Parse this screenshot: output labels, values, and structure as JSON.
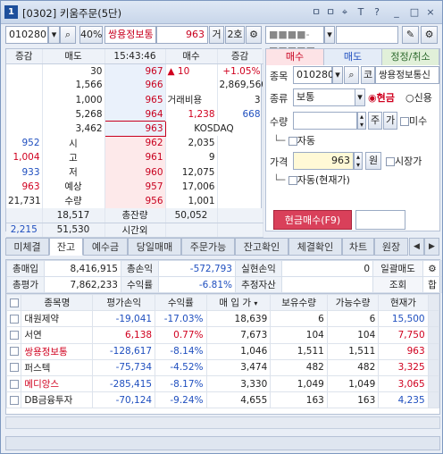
{
  "window": {
    "num": "1",
    "title": "[0302] 키움주문(5단)",
    "btns": [
      "ㅁ",
      "ㅁ",
      "≡",
      "T",
      "?",
      "_",
      "□",
      "×"
    ]
  },
  "top": {
    "code": "010280",
    "pct": "40%",
    "name": "쌍용정보통",
    "price": "963",
    "geo": "거",
    "ho": "2호",
    "acct": "■■■■-■■■■■",
    "pw": ""
  },
  "hoga": {
    "head": [
      "증감",
      "매도",
      "15:43:46",
      "매수",
      "증감"
    ],
    "asks": [
      {
        "qty": "30",
        "price": "967",
        "r1": "▲",
        "r2": "10",
        "r3": "+1.05%"
      },
      {
        "qty": "1,566",
        "price": "966",
        "r1": "",
        "r2": "",
        "r3": "2,869,560"
      },
      {
        "qty": "1,000",
        "price": "965",
        "r1": "거래비용",
        "r2": "",
        "r3": "3"
      },
      {
        "qty": "5,268",
        "price": "964",
        "r1": "",
        "r2": "1,238",
        "r3": "668"
      },
      {
        "qty": "3,462",
        "price": "963",
        "r1": "",
        "r2": "KOSDAQ",
        "r3": ""
      }
    ],
    "bids": [
      {
        "chg": "952",
        "label": "시",
        "price": "962",
        "qty": "2,035"
      },
      {
        "chg": "1,004",
        "label": "고",
        "price": "961",
        "qty": "9"
      },
      {
        "chg": "933",
        "label": "저",
        "price": "960",
        "qty": "12,075"
      },
      {
        "chg": "963",
        "label": "예상",
        "price": "957",
        "qty": "17,006"
      },
      {
        "chg": "21,731",
        "label": "수량",
        "price": "956",
        "qty": "1,001"
      }
    ],
    "foot1": {
      "ask": "18,517",
      "label": "총잔량",
      "bid": "50,052"
    },
    "foot2": {
      "chg": "2,215",
      "ask": "51,530",
      "label": "시간외",
      "bid": ""
    }
  },
  "order": {
    "tabs": [
      "매수",
      "매도",
      "정정/취소"
    ],
    "code_lbl": "종목",
    "code": "010280",
    "code_btn": "코",
    "name": "쌍용정보통신",
    "type_lbl": "종류",
    "type": "보통",
    "r1": "현금",
    "r2": "신용",
    "qty_lbl": "수량",
    "qty_btn1": "주",
    "qty_btn2": "가",
    "misu": "미수",
    "auto1": "자동",
    "price_lbl": "가격",
    "price": "963",
    "won": "원",
    "market": "시장가",
    "auto2": "자동(현재가)",
    "submit": "현금매수(F9)"
  },
  "tabs": [
    "미체결",
    "잔고",
    "예수금",
    "당일매매",
    "주문가능",
    "잔고확인",
    "체결확인",
    "차트",
    "원장"
  ],
  "summary": {
    "r1": [
      {
        "k": "총매입",
        "v": "8,416,915"
      },
      {
        "k": "총손익",
        "v": "-572,793"
      },
      {
        "k": "실현손익",
        "v": "0"
      },
      {
        "k": "일괄매도",
        "v": ""
      }
    ],
    "r2": [
      {
        "k": "총평가",
        "v": "7,862,233"
      },
      {
        "k": "수익률",
        "v": "-6.81%"
      },
      {
        "k": "추정자산",
        "v": ""
      },
      {
        "k": "조회",
        "v": "합"
      }
    ]
  },
  "grid": {
    "head": [
      "종목명",
      "평가손익",
      "수익률",
      "매 입 가",
      "보유수량",
      "가능수량",
      "현재가"
    ],
    "rows": [
      {
        "name": "대원제약",
        "pl": "-19,041",
        "rate": "-17.03%",
        "buy": "18,639",
        "hold": "6",
        "avail": "6",
        "cur": "15,500",
        "dir": "down"
      },
      {
        "name": "서연",
        "pl": "6,138",
        "rate": "0.77%",
        "buy": "7,673",
        "hold": "104",
        "avail": "104",
        "cur": "7,750",
        "dir": "up"
      },
      {
        "name": "쌍용정보통",
        "pl": "-128,617",
        "rate": "-8.14%",
        "buy": "1,046",
        "hold": "1,511",
        "avail": "1,511",
        "cur": "963",
        "dir": "up"
      },
      {
        "name": "퍼스텍",
        "pl": "-75,734",
        "rate": "-4.52%",
        "buy": "3,474",
        "hold": "482",
        "avail": "482",
        "cur": "3,325",
        "dir": "up"
      },
      {
        "name": "메디앙스",
        "pl": "-285,415",
        "rate": "-8.17%",
        "buy": "3,330",
        "hold": "1,049",
        "avail": "1,049",
        "cur": "3,065",
        "dir": "up"
      },
      {
        "name": "DB금융투자",
        "pl": "-70,124",
        "rate": "-9.24%",
        "buy": "4,655",
        "hold": "163",
        "avail": "163",
        "cur": "4,235",
        "dir": "down"
      }
    ]
  }
}
